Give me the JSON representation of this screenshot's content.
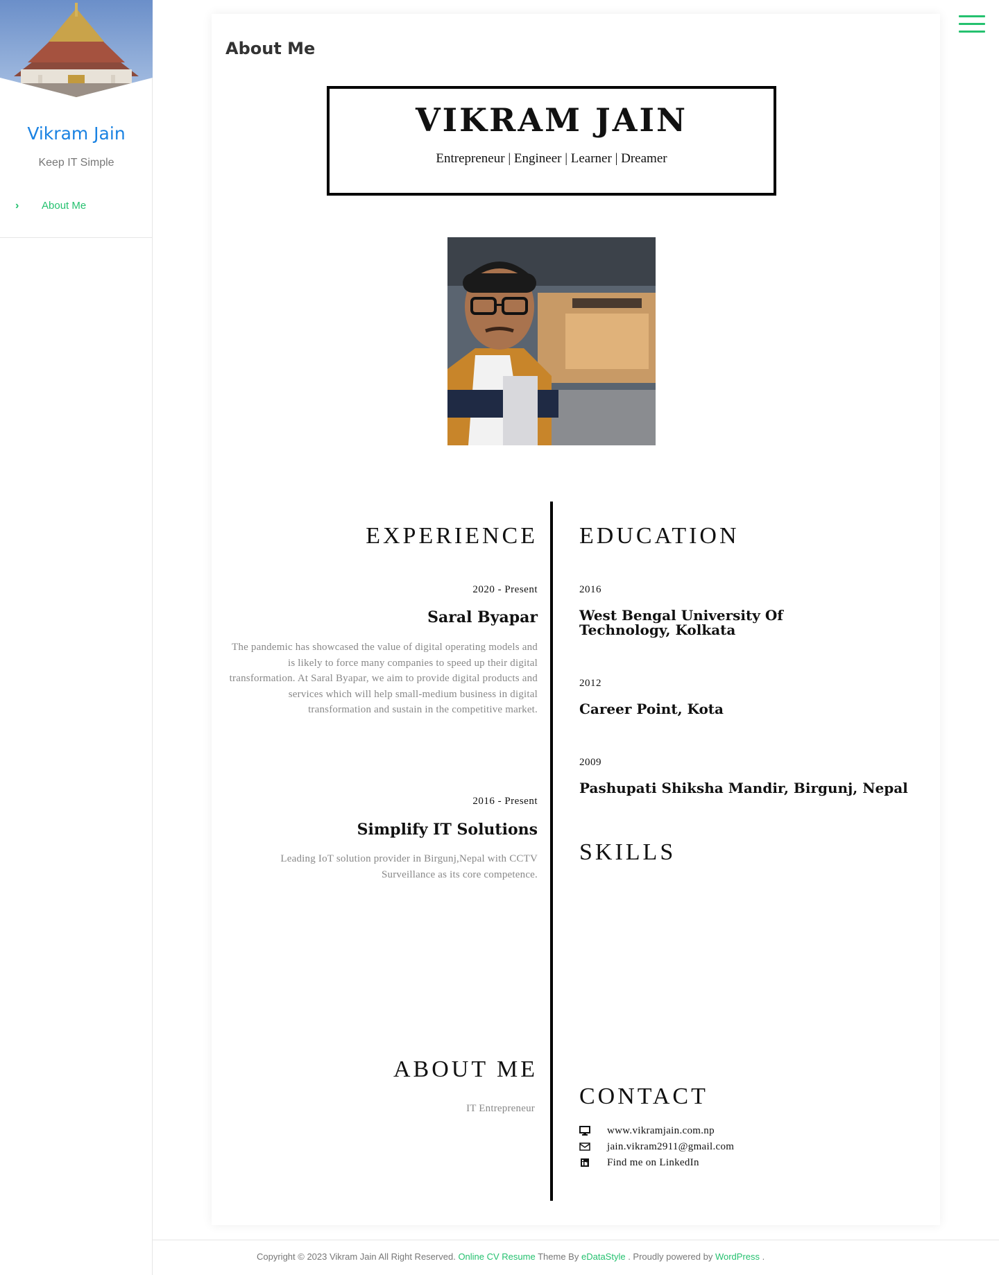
{
  "sidebar": {
    "site_title": "Vikram Jain",
    "tagline": "Keep IT Simple",
    "nav_items": [
      {
        "label": "About Me",
        "icon": "chevron-right-icon"
      }
    ]
  },
  "header": {
    "menu_icon": "hamburger-menu-icon"
  },
  "page": {
    "title": "About Me"
  },
  "resume": {
    "name": "VIKRAM JAIN",
    "roles": "Entrepreneur | Engineer | Learner | Dreamer",
    "experience": {
      "heading": "EXPERIENCE",
      "items": [
        {
          "period": "2020 - Present",
          "company": "Saral Byapar",
          "description": "The pandemic has showcased the value of digital operating models and is likely to force many companies to speed up their digital transformation. At Saral Byapar, we aim to provide digital products and services which will help small-medium business in digital transformation and sustain in the competitive market."
        },
        {
          "period": "2016 - Present",
          "company": "Simplify IT Solutions",
          "description": "Leading IoT solution provider in Birgunj,Nepal with CCTV Surveillance as its core competence."
        }
      ]
    },
    "education": {
      "heading": "EDUCATION",
      "items": [
        {
          "year": "2016",
          "school": "West Bengal University Of Technology, Kolkata"
        },
        {
          "year": "2012",
          "school": "Career Point, Kota"
        },
        {
          "year": "2009",
          "school": "Pashupati Shiksha Mandir, Birgunj, Nepal"
        }
      ]
    },
    "skills": {
      "heading": "SKILLS"
    },
    "about": {
      "heading": "ABOUT ME",
      "text": "IT Entrepreneur"
    },
    "contact": {
      "heading": "CONTACT",
      "items": [
        {
          "icon": "desktop-icon",
          "text": "www.vikramjain.com.np"
        },
        {
          "icon": "envelope-icon",
          "text": "jain.vikram2911@gmail.com"
        },
        {
          "icon": "linkedin-icon",
          "text": "Find me on LinkedIn"
        }
      ]
    }
  },
  "footer": {
    "copyright": "Copyright © 2023 Vikram Jain All Right Reserved.",
    "theme_link": "Online CV Resume",
    "theme_by": "Theme By",
    "author_link": "eDataStyle",
    "powered_by": ". Proudly powered by",
    "wp_link": "WordPress",
    "end": "."
  },
  "colors": {
    "accent_green": "#25c16f",
    "title_blue": "#1a82e2"
  }
}
